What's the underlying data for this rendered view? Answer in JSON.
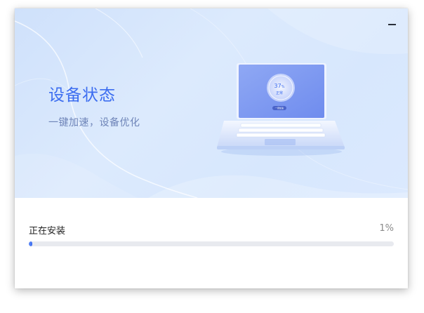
{
  "hero": {
    "title": "设备状态",
    "subtitle": "一键加速，设备优化"
  },
  "laptop_screen": {
    "value": "37",
    "unit": "%",
    "label": "正常",
    "button_label": "一键加速"
  },
  "window_controls": {
    "minimize_icon": "minimize-icon"
  },
  "install": {
    "status_label": "正在安装",
    "percent_text": "1%",
    "progress": 0.01
  },
  "colors": {
    "accent": "#3c6df0",
    "track": "#e8eaef",
    "hero_bg": "#d7e7fd"
  }
}
